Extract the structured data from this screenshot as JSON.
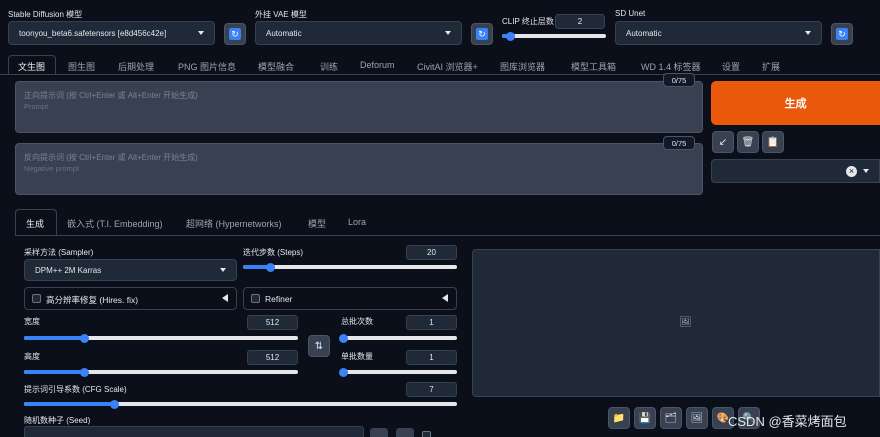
{
  "top": {
    "sd_model_label": "Stable Diffusion 模型",
    "sd_model_value": "toonyou_beta6.safetensors [e8d456c42e]",
    "vae_label": "外挂 VAE 模型",
    "vae_value": "Automatic",
    "clip_label": "CLIP 终止层数",
    "clip_value": "2",
    "clip_fraction": 0.08,
    "unet_label": "SD Unet",
    "unet_value": "Automatic",
    "refresh_glyph": "↻"
  },
  "tabs": [
    {
      "label": "文生图",
      "active": true
    },
    {
      "label": "图生图"
    },
    {
      "label": "后期处理"
    },
    {
      "label": "PNG 图片信息"
    },
    {
      "label": "模型融合"
    },
    {
      "label": "训练"
    },
    {
      "label": "Deforum"
    },
    {
      "label": "CivitAI 浏览器+"
    },
    {
      "label": "图库浏览器"
    },
    {
      "label": "模型工具箱"
    },
    {
      "label": "WD 1.4 标签器"
    },
    {
      "label": "设置"
    },
    {
      "label": "扩展"
    }
  ],
  "prompt": {
    "placeholder_cn": "正向提示词 (按 Ctrl+Enter 或 Alt+Enter 开始生成)",
    "placeholder_en": "Prompt",
    "counter": "0/75"
  },
  "negative": {
    "placeholder_cn": "反向提示词 (按 Ctrl+Enter 或 Alt+Enter 开始生成)",
    "placeholder_en": "Negative prompt",
    "counter": "0/75"
  },
  "generate_label": "生成",
  "action_icons": {
    "arrow": "↙",
    "trash": "🗑",
    "clipboard": "📋",
    "close": "×"
  },
  "subtabs": [
    "生成",
    "嵌入式 (T.I. Embedding)",
    "超网络 (Hypernetworks)",
    "模型",
    "Lora"
  ],
  "sampler": {
    "label": "采样方法 (Sampler)",
    "value": "DPM++ 2M Karras"
  },
  "steps": {
    "label": "迭代步数 (Steps)",
    "value": "20",
    "fraction": 0.13
  },
  "hires": {
    "label": "高分辨率修复 (Hires. fix)"
  },
  "refiner": {
    "label": "Refiner"
  },
  "width": {
    "label": "宽度",
    "value": "512",
    "fraction": 0.22
  },
  "height": {
    "label": "高度",
    "value": "512",
    "fraction": 0.22
  },
  "swap_glyph": "⇅",
  "batch_count": {
    "label": "总批次数",
    "value": "1",
    "fraction": 0.02
  },
  "batch_size": {
    "label": "单批数量",
    "value": "1",
    "fraction": 0.02
  },
  "cfg": {
    "label": "提示词引导系数 (CFG Scale)",
    "value": "7",
    "fraction": 0.21
  },
  "seed": {
    "label": "随机数种子 (Seed)"
  },
  "watermark": "CSDN @香菜烤面包",
  "image_icon": "🖼",
  "output_tools": [
    "📁",
    "💾",
    "🗂",
    "🖼",
    "🎨",
    "🔍"
  ],
  "colors": {
    "accent": "#3b82f6",
    "generate": "#ea580c"
  }
}
